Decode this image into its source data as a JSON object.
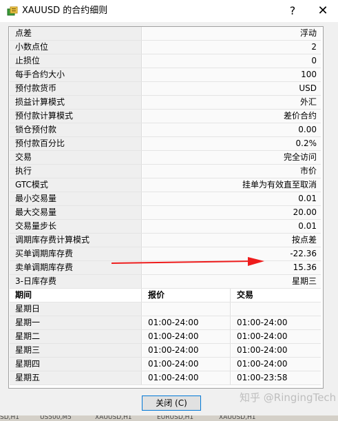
{
  "window": {
    "title": "XAUUSD 的合约细则",
    "help_label": "?",
    "close_label": "✕"
  },
  "specs": [
    {
      "key": "点差",
      "value": "浮动"
    },
    {
      "key": "小数点位",
      "value": "2"
    },
    {
      "key": "止损位",
      "value": "0"
    },
    {
      "key": "每手合约大小",
      "value": "100"
    },
    {
      "key": "预付款货币",
      "value": "USD"
    },
    {
      "key": "损益计算模式",
      "value": "外汇"
    },
    {
      "key": "预付款计算模式",
      "value": "差价合约"
    },
    {
      "key": "锁仓预付款",
      "value": "0.00"
    },
    {
      "key": "预付款百分比",
      "value": "0.2%"
    },
    {
      "key": "交易",
      "value": "完全访问"
    },
    {
      "key": "执行",
      "value": "市价"
    },
    {
      "key": "GTC模式",
      "value": "挂单为有效直至取消"
    },
    {
      "key": "最小交易量",
      "value": "0.01"
    },
    {
      "key": "最大交易量",
      "value": "20.00"
    },
    {
      "key": "交易量步长",
      "value": "0.01"
    },
    {
      "key": "调期库存费计算模式",
      "value": "按点差"
    },
    {
      "key": "买单调期库存费",
      "value": "-22.36"
    },
    {
      "key": "卖单调期库存费",
      "value": "15.36"
    },
    {
      "key": "3-日库存费",
      "value": "星期三"
    }
  ],
  "schedule": {
    "headers": [
      "期间",
      "报价",
      "交易"
    ],
    "rows": [
      {
        "day": "星期日",
        "quote": "",
        "trade": ""
      },
      {
        "day": "星期一",
        "quote": "01:00-24:00",
        "trade": "01:00-24:00"
      },
      {
        "day": "星期二",
        "quote": "01:00-24:00",
        "trade": "01:00-24:00"
      },
      {
        "day": "星期三",
        "quote": "01:00-24:00",
        "trade": "01:00-24:00"
      },
      {
        "day": "星期四",
        "quote": "01:00-24:00",
        "trade": "01:00-24:00"
      },
      {
        "day": "星期五",
        "quote": "01:00-24:00",
        "trade": "01:00-23:58"
      }
    ]
  },
  "footer": {
    "close_button": "关闭 (C)"
  },
  "watermark": "知乎 @RingingTech",
  "taskbar": {
    "tabs": [
      "SD,H1",
      "US500,M5",
      "XAUUSD,H1",
      "EURUSD,H1",
      "XAUUSD,H1"
    ]
  },
  "colors": {
    "arrow": "#ee1c1c",
    "window_bg": "#f0f0f0",
    "button_border": "#0078d7"
  }
}
